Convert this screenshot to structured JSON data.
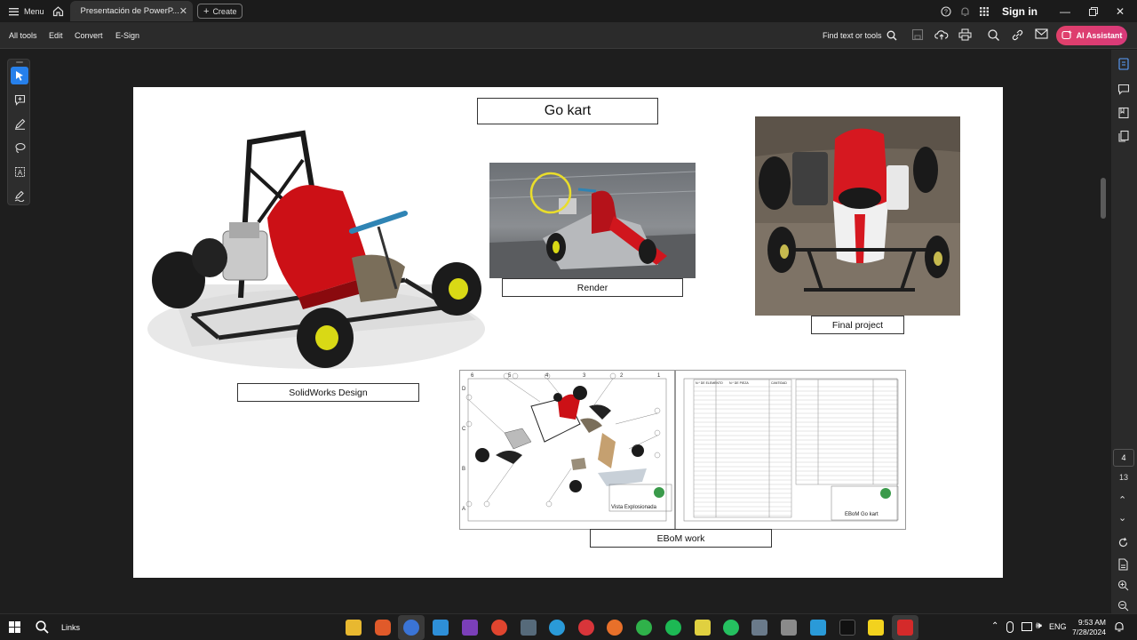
{
  "titlebar": {
    "menu_label": "Menu",
    "tab_title": "Presentación de PowerP...",
    "create_label": "Create",
    "sign_in": "Sign in"
  },
  "toolbar": {
    "items": [
      "All tools",
      "Edit",
      "Convert",
      "E-Sign"
    ],
    "find_label": "Find text or tools",
    "ai_label": "AI Assistant"
  },
  "slide": {
    "title": "Go kart",
    "captions": {
      "solidworks": "SolidWorks Design",
      "render": "Render",
      "final": "Final project",
      "ebom": "EBoM work"
    },
    "drawing_left_title": "Vista Explosionada",
    "drawing_right_title": "EBoM Go kart",
    "drawing_cols": [
      "6",
      "5",
      "4",
      "3",
      "2",
      "1"
    ],
    "drawing_rows": [
      "D",
      "C",
      "B",
      "A"
    ],
    "bom_headers": [
      "N.º DE ELEMENTO",
      "N.º DE PIEZA",
      "CANTIDAD"
    ]
  },
  "page_nav": {
    "current": "4",
    "total": "13"
  },
  "taskbar": {
    "search_label": "Links",
    "lang": "ENG",
    "time": "9:53 AM",
    "date": "7/28/2024"
  },
  "colors": {
    "accent": "#2680eb",
    "ai_button": "#e0406a",
    "kart_red": "#d9141a"
  }
}
